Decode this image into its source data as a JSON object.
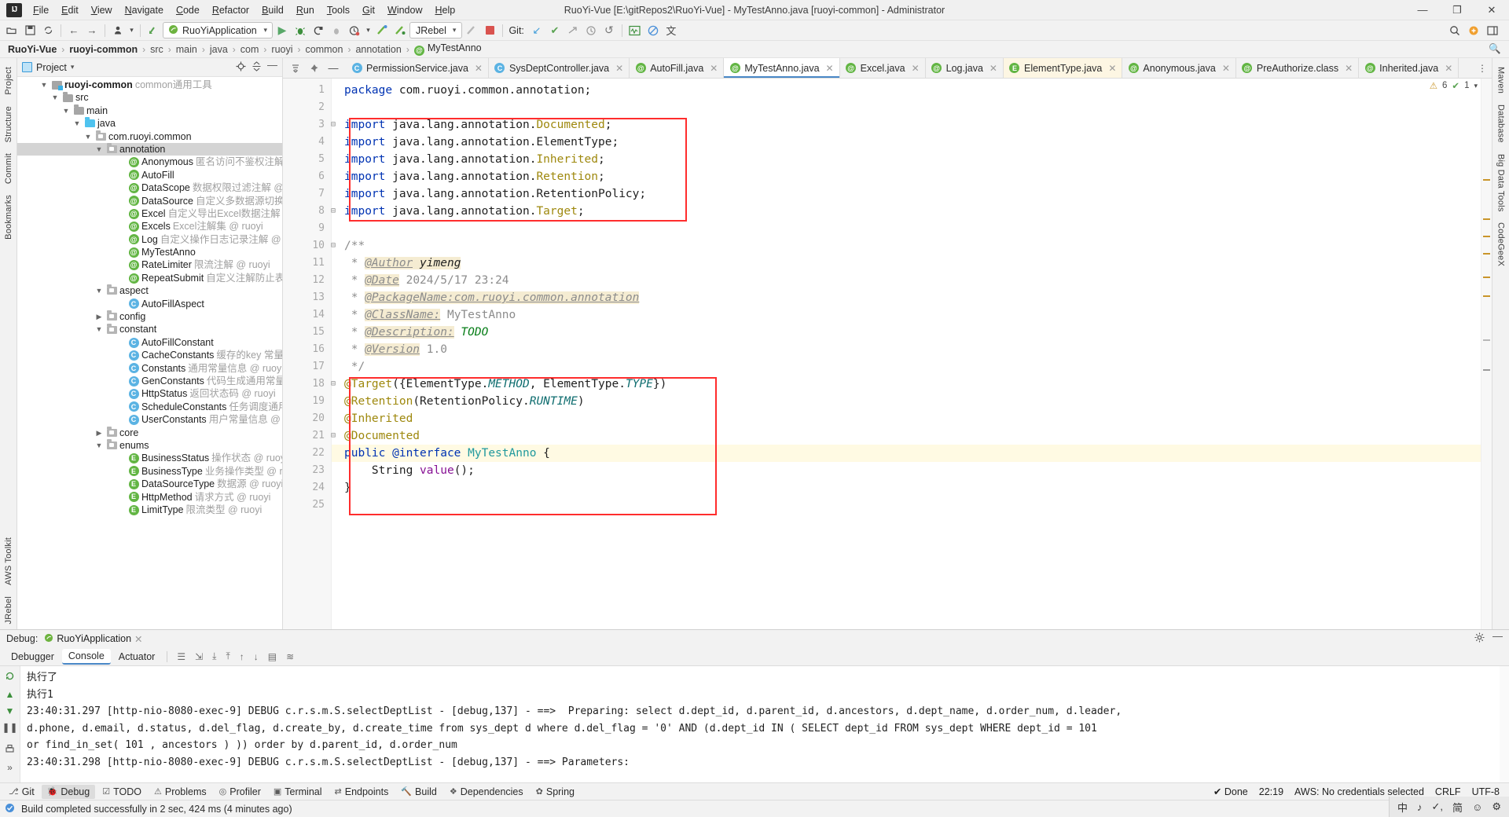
{
  "window": {
    "title": "RuoYi-Vue [E:\\gitRepos2\\RuoYi-Vue] - MyTestAnno.java [ruoyi-common] - Administrator",
    "minimize": "—",
    "maximize": "❐",
    "close": "✕",
    "logo": "IJ"
  },
  "menubar": [
    "File",
    "Edit",
    "View",
    "Navigate",
    "Code",
    "Refactor",
    "Build",
    "Run",
    "Tools",
    "Git",
    "Window",
    "Help"
  ],
  "toolbar": {
    "open_icon": "open-icon",
    "save_icon": "save-icon",
    "sync_icon": "sync-icon",
    "back_icon": "←",
    "forward_icon": "→",
    "profile_icon": "profile-icon",
    "update_icon": "update-icon",
    "run_config": "RuoYiApplication",
    "run_icon": "▶",
    "debug_icon": "debug-icon",
    "coverage_icon": "coverage-icon",
    "profiler_icon": "profiler-icon",
    "more_run_icon": "more-run-icon",
    "build_icon": "build-icon",
    "rebuild_icon": "rebuild-icon",
    "jrebel": "JRebel",
    "stop_icon": "stop-icon",
    "git_label": "Git:",
    "git_update_icon": "↙",
    "git_commit_icon": "✔",
    "git_push_icon": "push-icon",
    "git_history_icon": "history-icon",
    "git_rollback_icon": "↺",
    "monitor_icon": "monitor-icon",
    "block_icon": "block-icon",
    "translate_icon": "translate-icon",
    "search_icon": "search-icon",
    "plugin_icon": "plugin-icon",
    "layout_icon": "layout-icon"
  },
  "breadcrumb": {
    "items": [
      {
        "label": "RuoYi-Vue",
        "style": "bold"
      },
      {
        "label": "ruoyi-common",
        "style": "bold"
      },
      {
        "label": "src",
        "style": "dim"
      },
      {
        "label": "main",
        "style": "dim"
      },
      {
        "label": "java",
        "style": "dim"
      },
      {
        "label": "com",
        "style": "dim"
      },
      {
        "label": "ruoyi",
        "style": "dim"
      },
      {
        "label": "common",
        "style": "dim"
      },
      {
        "label": "annotation",
        "style": "dim"
      },
      {
        "label": "MyTestAnno",
        "style": "file",
        "icon": "annotation-icon"
      }
    ]
  },
  "left_rail": [
    "Project",
    "Structure",
    "Commit",
    "Bookmarks"
  ],
  "left_rail_bottom": [
    "AWS Toolkit",
    "JRebel"
  ],
  "right_rail": [
    "Maven",
    "Database",
    "Big Data Tools",
    "CodeGeeX"
  ],
  "project_panel": {
    "title": "Project",
    "tree": [
      {
        "indent": 2,
        "arrow": "v",
        "icon": "module-icon",
        "name": "ruoyi-common",
        "bold": true,
        "desc": "common通用工具",
        "selected": false
      },
      {
        "indent": 3,
        "arrow": "v",
        "icon": "folder-icon",
        "name": "src",
        "desc": "",
        "selected": false
      },
      {
        "indent": 4,
        "arrow": "v",
        "icon": "folder-icon",
        "name": "main",
        "desc": "",
        "selected": false
      },
      {
        "indent": 5,
        "arrow": "v",
        "icon": "source-folder-icon",
        "name": "java",
        "desc": "",
        "selected": false
      },
      {
        "indent": 6,
        "arrow": "v",
        "icon": "package-icon",
        "name": "com.ruoyi.common",
        "desc": "",
        "selected": false
      },
      {
        "indent": 7,
        "arrow": "v",
        "icon": "package-icon",
        "name": "annotation",
        "desc": "",
        "selected": true
      },
      {
        "indent": 9,
        "arrow": "",
        "icon": "annotation-icon",
        "name": "Anonymous",
        "desc": "匿名访问不鉴权注解 @ ruoyi"
      },
      {
        "indent": 9,
        "arrow": "",
        "icon": "annotation-icon",
        "name": "AutoFill",
        "desc": ""
      },
      {
        "indent": 9,
        "arrow": "",
        "icon": "annotation-icon",
        "name": "DataScope",
        "desc": "数据权限过滤注解 @ ruoyi"
      },
      {
        "indent": 9,
        "arrow": "",
        "icon": "annotation-icon",
        "name": "DataSource",
        "desc": "自定义多数据源切换注解 @ ruoyi"
      },
      {
        "indent": 9,
        "arrow": "",
        "icon": "annotation-icon",
        "name": "Excel",
        "desc": "自定义导出Excel数据注解 @ ruoyi"
      },
      {
        "indent": 9,
        "arrow": "",
        "icon": "annotation-icon",
        "name": "Excels",
        "desc": "Excel注解集 @ ruoyi"
      },
      {
        "indent": 9,
        "arrow": "",
        "icon": "annotation-icon",
        "name": "Log",
        "desc": "自定义操作日志记录注解 @ ruoyi"
      },
      {
        "indent": 9,
        "arrow": "",
        "icon": "annotation-icon",
        "name": "MyTestAnno",
        "desc": ""
      },
      {
        "indent": 9,
        "arrow": "",
        "icon": "annotation-icon",
        "name": "RateLimiter",
        "desc": "限流注解 @ ruoyi"
      },
      {
        "indent": 9,
        "arrow": "",
        "icon": "annotation-icon",
        "name": "RepeatSubmit",
        "desc": "自定义注解防止表单重复提交 @"
      },
      {
        "indent": 7,
        "arrow": "v",
        "icon": "package-icon",
        "name": "aspect",
        "desc": ""
      },
      {
        "indent": 9,
        "arrow": "",
        "icon": "class-icon",
        "name": "AutoFillAspect",
        "desc": ""
      },
      {
        "indent": 7,
        "arrow": ">",
        "icon": "package-icon",
        "name": "config",
        "desc": ""
      },
      {
        "indent": 7,
        "arrow": "v",
        "icon": "package-icon",
        "name": "constant",
        "desc": ""
      },
      {
        "indent": 9,
        "arrow": "",
        "icon": "class-icon",
        "name": "AutoFillConstant",
        "desc": ""
      },
      {
        "indent": 9,
        "arrow": "",
        "icon": "class-icon",
        "name": "CacheConstants",
        "desc": "缓存的key 常量 @ ruoyi"
      },
      {
        "indent": 9,
        "arrow": "",
        "icon": "class-icon",
        "name": "Constants",
        "desc": "通用常量信息 @ ruoyi"
      },
      {
        "indent": 9,
        "arrow": "",
        "icon": "class-icon",
        "name": "GenConstants",
        "desc": "代码生成通用常量 @ ruoyi"
      },
      {
        "indent": 9,
        "arrow": "",
        "icon": "class-icon",
        "name": "HttpStatus",
        "desc": "返回状态码 @ ruoyi"
      },
      {
        "indent": 9,
        "arrow": "",
        "icon": "class-icon",
        "name": "ScheduleConstants",
        "desc": "任务调度通用常量 @ ruoyi"
      },
      {
        "indent": 9,
        "arrow": "",
        "icon": "class-icon",
        "name": "UserConstants",
        "desc": "用户常量信息 @ ruoyi"
      },
      {
        "indent": 7,
        "arrow": ">",
        "icon": "package-icon",
        "name": "core",
        "desc": ""
      },
      {
        "indent": 7,
        "arrow": "v",
        "icon": "package-icon",
        "name": "enums",
        "desc": ""
      },
      {
        "indent": 9,
        "arrow": "",
        "icon": "enum-icon",
        "name": "BusinessStatus",
        "desc": "操作状态 @ ruoyi"
      },
      {
        "indent": 9,
        "arrow": "",
        "icon": "enum-icon",
        "name": "BusinessType",
        "desc": "业务操作类型 @ ruoyi"
      },
      {
        "indent": 9,
        "arrow": "",
        "icon": "enum-icon",
        "name": "DataSourceType",
        "desc": "数据源 @ ruoyi"
      },
      {
        "indent": 9,
        "arrow": "",
        "icon": "enum-icon",
        "name": "HttpMethod",
        "desc": "请求方式 @ ruoyi"
      },
      {
        "indent": 9,
        "arrow": "",
        "icon": "enum-icon",
        "name": "LimitType",
        "desc": "限流类型 @ ruoyi"
      }
    ]
  },
  "editor": {
    "tabs": [
      {
        "label": "PermissionService.java",
        "icon": "class-icon",
        "state": "normal"
      },
      {
        "label": "SysDeptController.java",
        "icon": "class-icon",
        "state": "normal"
      },
      {
        "label": "AutoFill.java",
        "icon": "annotation-icon",
        "state": "normal"
      },
      {
        "label": "MyTestAnno.java",
        "icon": "annotation-icon",
        "state": "active"
      },
      {
        "label": "Excel.java",
        "icon": "annotation-icon",
        "state": "normal"
      },
      {
        "label": "Log.java",
        "icon": "annotation-icon",
        "state": "normal"
      },
      {
        "label": "ElementType.java",
        "icon": "enum-icon",
        "state": "highlight"
      },
      {
        "label": "Anonymous.java",
        "icon": "annotation-icon",
        "state": "normal"
      },
      {
        "label": "PreAuthorize.class",
        "icon": "annotation-icon",
        "state": "normal"
      },
      {
        "label": "Inherited.java",
        "icon": "annotation-icon",
        "state": "normal"
      }
    ],
    "inspection": {
      "warnings": "6",
      "checks": "1",
      "warn_icon": "warning-icon",
      "ok_icon": "ok-icon"
    },
    "lines": [
      {
        "n": "1",
        "fold": "",
        "segments": [
          {
            "t": "package ",
            "c": "k"
          },
          {
            "t": "com.ruoyi.common.annotation;",
            "c": "plain"
          }
        ]
      },
      {
        "n": "2",
        "fold": "",
        "segments": []
      },
      {
        "n": "3",
        "fold": "-",
        "segments": [
          {
            "t": "import ",
            "c": "k"
          },
          {
            "t": "java.lang.annotation.",
            "c": "plain"
          },
          {
            "t": "Documented",
            "c": "ann"
          },
          {
            "t": ";",
            "c": "plain"
          }
        ]
      },
      {
        "n": "4",
        "fold": "",
        "segments": [
          {
            "t": "import ",
            "c": "k"
          },
          {
            "t": "java.lang.annotation.ElementType;",
            "c": "plain"
          }
        ]
      },
      {
        "n": "5",
        "fold": "",
        "segments": [
          {
            "t": "import ",
            "c": "k"
          },
          {
            "t": "java.lang.annotation.",
            "c": "plain"
          },
          {
            "t": "Inherited",
            "c": "ann"
          },
          {
            "t": ";",
            "c": "plain"
          }
        ]
      },
      {
        "n": "6",
        "fold": "",
        "segments": [
          {
            "t": "import ",
            "c": "k"
          },
          {
            "t": "java.lang.annotation.",
            "c": "plain"
          },
          {
            "t": "Retention",
            "c": "ann"
          },
          {
            "t": ";",
            "c": "plain"
          }
        ]
      },
      {
        "n": "7",
        "fold": "",
        "segments": [
          {
            "t": "import ",
            "c": "k"
          },
          {
            "t": "java.lang.annotation.RetentionPolicy;",
            "c": "plain"
          }
        ]
      },
      {
        "n": "8",
        "fold": "-",
        "segments": [
          {
            "t": "import ",
            "c": "k"
          },
          {
            "t": "java.lang.annotation.",
            "c": "plain"
          },
          {
            "t": "Target",
            "c": "ann"
          },
          {
            "t": ";",
            "c": "plain"
          }
        ]
      },
      {
        "n": "9",
        "fold": "",
        "segments": []
      },
      {
        "n": "10",
        "fold": "-",
        "segments": [
          {
            "t": "/**",
            "c": "cmt"
          }
        ]
      },
      {
        "n": "11",
        "fold": "",
        "segments": [
          {
            "t": " * ",
            "c": "cmt"
          },
          {
            "t": "@Author",
            "c": "cmt-tag"
          },
          {
            "t": " yimeng",
            "c": "cmt-hl"
          }
        ]
      },
      {
        "n": "12",
        "fold": "",
        "segments": [
          {
            "t": " * ",
            "c": "cmt"
          },
          {
            "t": "@Date",
            "c": "cmt-tag"
          },
          {
            "t": " 2024/5/17 23:24",
            "c": "cmt"
          }
        ]
      },
      {
        "n": "13",
        "fold": "",
        "segments": [
          {
            "t": " * ",
            "c": "cmt"
          },
          {
            "t": "@PackageName:com.ruoyi.common.annotation",
            "c": "cmt-tag"
          }
        ]
      },
      {
        "n": "14",
        "fold": "",
        "segments": [
          {
            "t": " * ",
            "c": "cmt"
          },
          {
            "t": "@ClassName:",
            "c": "cmt-tag"
          },
          {
            "t": " MyTestAnno",
            "c": "cmt"
          }
        ]
      },
      {
        "n": "15",
        "fold": "",
        "segments": [
          {
            "t": " * ",
            "c": "cmt"
          },
          {
            "t": "@Description:",
            "c": "cmt-tag"
          },
          {
            "t": " TODO",
            "c": "todo"
          }
        ]
      },
      {
        "n": "16",
        "fold": "",
        "segments": [
          {
            "t": " * ",
            "c": "cmt"
          },
          {
            "t": "@Version",
            "c": "cmt-tag"
          },
          {
            "t": " 1.0",
            "c": "cmt"
          }
        ]
      },
      {
        "n": "17",
        "fold": "",
        "segments": [
          {
            "t": " */",
            "c": "cmt"
          }
        ]
      },
      {
        "n": "18",
        "fold": "-",
        "segments": [
          {
            "t": "@Target",
            "c": "ann"
          },
          {
            "t": "({ElementType.",
            "c": "plain"
          },
          {
            "t": "METHOD",
            "c": "static-ital"
          },
          {
            "t": ", ElementType.",
            "c": "plain"
          },
          {
            "t": "TYPE",
            "c": "static-ital"
          },
          {
            "t": "})",
            "c": "plain"
          }
        ]
      },
      {
        "n": "19",
        "fold": "",
        "segments": [
          {
            "t": "@Retention",
            "c": "ann"
          },
          {
            "t": "(RetentionPolicy.",
            "c": "plain"
          },
          {
            "t": "RUNTIME",
            "c": "static-ital"
          },
          {
            "t": ")",
            "c": "plain"
          }
        ]
      },
      {
        "n": "20",
        "fold": "",
        "segments": [
          {
            "t": "@Inherited",
            "c": "ann"
          }
        ]
      },
      {
        "n": "21",
        "fold": "-",
        "segments": [
          {
            "t": "@Documented",
            "c": "ann"
          }
        ]
      },
      {
        "n": "22",
        "fold": "",
        "hl": true,
        "segments": [
          {
            "t": "public ",
            "c": "k"
          },
          {
            "t": "@interface ",
            "c": "k"
          },
          {
            "t": "MyTestAnno",
            "c": "typ"
          },
          {
            "t": " {",
            "c": "plain"
          }
        ]
      },
      {
        "n": "23",
        "fold": "",
        "segments": [
          {
            "t": "    String ",
            "c": "plain"
          },
          {
            "t": "value",
            "c": "field"
          },
          {
            "t": "();",
            "c": "plain"
          }
        ]
      },
      {
        "n": "24",
        "fold": "",
        "segments": [
          {
            "t": "}",
            "c": "plain"
          }
        ]
      },
      {
        "n": "25",
        "fold": "",
        "segments": []
      }
    ]
  },
  "debug": {
    "title": "Debug:",
    "config": "RuoYiApplication",
    "tabs": [
      "Debugger",
      "Console",
      "Actuator"
    ],
    "active_tab": "Console",
    "console_lines": [
      "执行了",
      "执行1",
      "23:40:31.297 [http-nio-8080-exec-9] DEBUG c.r.s.m.S.selectDeptList - [debug,137] - ==>  Preparing: select d.dept_id, d.parent_id, d.ancestors, d.dept_name, d.order_num, d.leader,",
      "d.phone, d.email, d.status, d.del_flag, d.create_by, d.create_time from sys_dept d where d.del_flag = '0' AND (d.dept_id IN ( SELECT dept_id FROM sys_dept WHERE dept_id = 101",
      "or find_in_set( 101 , ancestors ) )) order by d.parent_id, d.order_num",
      "23:40:31.298 [http-nio-8080-exec-9] DEBUG c.r.s.m.S.selectDeptList - [debug,137] - ==> Parameters:"
    ]
  },
  "tool_windows": {
    "left_items": [
      {
        "label": "Git",
        "icon": "git-icon",
        "active": false
      },
      {
        "label": "Debug",
        "icon": "debug-icon",
        "active": true
      },
      {
        "label": "TODO",
        "icon": "todo-icon",
        "active": false
      },
      {
        "label": "Problems",
        "icon": "problems-icon",
        "active": false
      },
      {
        "label": "Profiler",
        "icon": "profiler-icon",
        "active": false
      },
      {
        "label": "Terminal",
        "icon": "terminal-icon",
        "active": false
      },
      {
        "label": "Endpoints",
        "icon": "endpoints-icon",
        "active": false
      },
      {
        "label": "Build",
        "icon": "build-icon",
        "active": false
      },
      {
        "label": "Dependencies",
        "icon": "dependencies-icon",
        "active": false
      },
      {
        "label": "Spring",
        "icon": "spring-icon",
        "active": false
      }
    ],
    "right": {
      "done_icon": "done-icon",
      "done": "Done",
      "time": "22:19",
      "aws": "AWS: No credentials selected",
      "crlf": "CRLF",
      "encoding": "UTF-8"
    }
  },
  "statusbar": {
    "message": "Build completed successfully in 2 sec, 424 ms (4 minutes ago)",
    "ime": [
      "中",
      "♪",
      "✓,",
      "简",
      "☺",
      "⚙"
    ]
  }
}
